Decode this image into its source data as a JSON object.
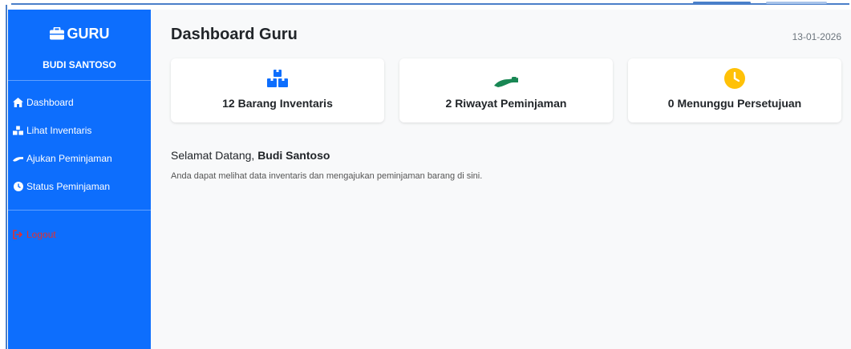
{
  "sidebar": {
    "brand": "GURU",
    "username": "BUDI SANTOSO",
    "items": [
      {
        "label": "Dashboard",
        "icon": "home-icon"
      },
      {
        "label": "Lihat Inventaris",
        "icon": "boxes-icon"
      },
      {
        "label": "Ajukan Peminjaman",
        "icon": "hand-icon"
      },
      {
        "label": "Status Peminjaman",
        "icon": "clock-icon"
      }
    ],
    "logout": "Logout"
  },
  "header": {
    "title": "Dashboard Guru",
    "date": "13-01-2026"
  },
  "cards": [
    {
      "label": "12 Barang Inventaris",
      "icon": "boxes-icon",
      "color": "#0d6efd"
    },
    {
      "label": "2 Riwayat Peminjaman",
      "icon": "hand-icon",
      "color": "#198754"
    },
    {
      "label": "0 Menunggu Persetujuan",
      "icon": "clock-icon",
      "color": "#ffc107"
    }
  ],
  "welcome": {
    "greeting": "Selamat Datang,",
    "name": "Budi Santoso",
    "description": "Anda dapat melihat data inventaris dan mengajukan peminjaman barang di sini."
  },
  "colors": {
    "sidebar": "#0d6efd",
    "logout": "#e0302f",
    "background": "#f8f9fa"
  }
}
